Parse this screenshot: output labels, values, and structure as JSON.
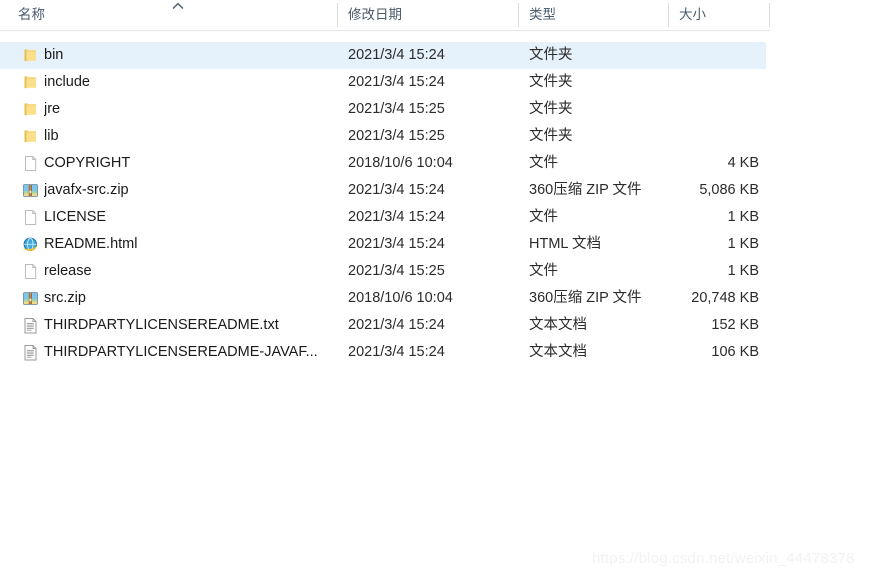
{
  "columns": {
    "name": "名称",
    "date": "修改日期",
    "type": "类型",
    "size": "大小",
    "sort_indicator": "ascending-chevron"
  },
  "files": [
    {
      "name": "bin",
      "date": "2021/3/4 15:24",
      "type": "文件夹",
      "size": "",
      "icon": "folder-icon",
      "selected": true
    },
    {
      "name": "include",
      "date": "2021/3/4 15:24",
      "type": "文件夹",
      "size": "",
      "icon": "folder-icon",
      "selected": false
    },
    {
      "name": "jre",
      "date": "2021/3/4 15:25",
      "type": "文件夹",
      "size": "",
      "icon": "folder-icon",
      "selected": false
    },
    {
      "name": "lib",
      "date": "2021/3/4 15:25",
      "type": "文件夹",
      "size": "",
      "icon": "folder-icon",
      "selected": false
    },
    {
      "name": "COPYRIGHT",
      "date": "2018/10/6 10:04",
      "type": "文件",
      "size": "4 KB",
      "icon": "blank-file-icon",
      "selected": false
    },
    {
      "name": "javafx-src.zip",
      "date": "2021/3/4 15:24",
      "type": "360压缩 ZIP 文件",
      "size": "5,086 KB",
      "icon": "zip-archive-icon",
      "selected": false
    },
    {
      "name": "LICENSE",
      "date": "2021/3/4 15:24",
      "type": "文件",
      "size": "1 KB",
      "icon": "blank-file-icon",
      "selected": false
    },
    {
      "name": "README.html",
      "date": "2021/3/4 15:24",
      "type": "HTML 文档",
      "size": "1 KB",
      "icon": "html-document-icon",
      "selected": false
    },
    {
      "name": "release",
      "date": "2021/3/4 15:25",
      "type": "文件",
      "size": "1 KB",
      "icon": "blank-file-icon",
      "selected": false
    },
    {
      "name": "src.zip",
      "date": "2018/10/6 10:04",
      "type": "360压缩 ZIP 文件",
      "size": "20,748 KB",
      "icon": "zip-archive-icon",
      "selected": false
    },
    {
      "name": "THIRDPARTYLICENSEREADME.txt",
      "date": "2021/3/4 15:24",
      "type": "文本文档",
      "size": "152 KB",
      "icon": "text-document-icon",
      "selected": false
    },
    {
      "name": "THIRDPARTYLICENSEREADME-JAVAF...",
      "date": "2021/3/4 15:24",
      "type": "文本文档",
      "size": "106 KB",
      "icon": "text-document-icon",
      "selected": false
    }
  ],
  "watermark": {
    "text": "https://blog.csdn.net/weixin_44478378"
  },
  "colors": {
    "selection": "#e5f1fb",
    "header_text": "#4a5b6b",
    "divider": "#dcdcdc",
    "folder": "#f7d274",
    "watermark": "#f2f2f2"
  }
}
